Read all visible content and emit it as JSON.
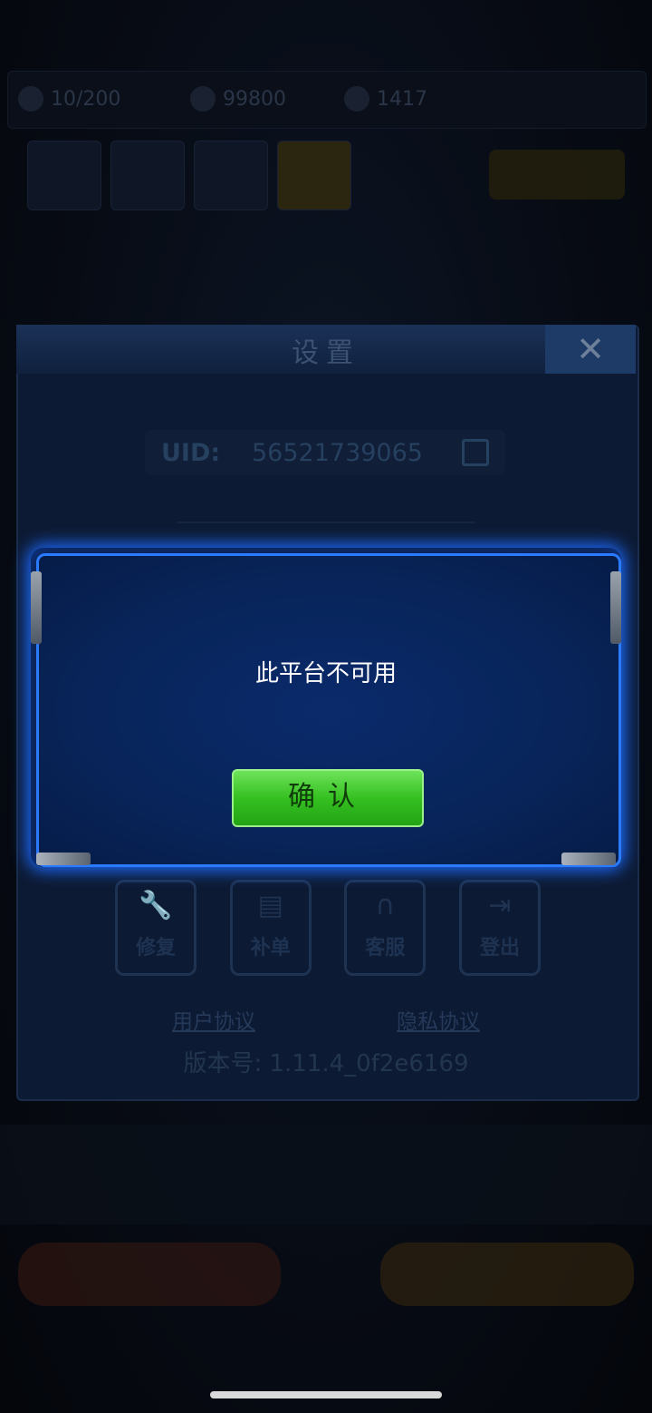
{
  "background": {
    "resources": [
      "10/200",
      "99800",
      "1417"
    ]
  },
  "settings": {
    "title": "设置",
    "close_label": "✕",
    "uid_label": "UID:",
    "uid_value": "56521739065",
    "actions": [
      {
        "label": "修复",
        "icon": "wrench-icon"
      },
      {
        "label": "补单",
        "icon": "order-icon"
      },
      {
        "label": "客服",
        "icon": "headset-icon"
      },
      {
        "label": "登出",
        "icon": "logout-icon"
      }
    ],
    "user_agreement": "用户协议",
    "privacy_agreement": "隐私协议",
    "version": "版本号: 1.11.4_0f2e6169"
  },
  "modal": {
    "message": "此平台不可用",
    "confirm_label": "确认"
  }
}
